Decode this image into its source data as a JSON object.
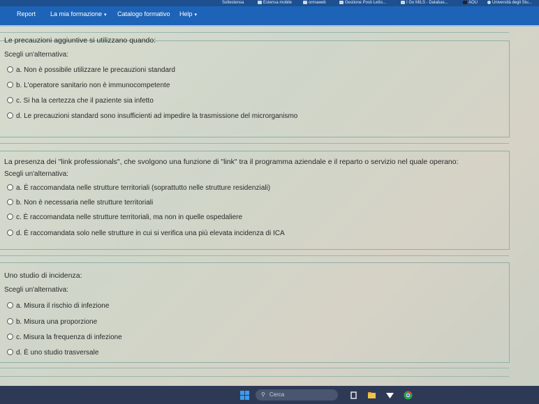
{
  "bookmarks": [
    {
      "label": "Soltestensa"
    },
    {
      "label": "Estensa mobile"
    },
    {
      "label": "ormaweb"
    },
    {
      "label": "Gestione Posti Letto..."
    },
    {
      "label": "I Go MILS - Databas..."
    },
    {
      "label": "AOU"
    },
    {
      "label": "Università degli Stu..."
    }
  ],
  "nav": {
    "report": "Report",
    "training": "La mia formazione",
    "catalog": "Catalogo formativo",
    "help": "Help"
  },
  "questions": [
    {
      "text": "Le precauzioni aggiuntive si utilizzano quando:",
      "prompt": "Scegli un'alternativa:",
      "options": [
        "a. Non è possibile utilizzare le precauzioni standard",
        "b. L'operatore sanitario non è immunocompetente",
        "c. Si ha la certezza che il paziente sia infetto",
        "d. Le precauzioni standard sono insufficienti ad impedire la trasmissione del microrganismo"
      ]
    },
    {
      "text": "La presenza dei \"link professionals\", che svolgono una funzione di \"link\" tra il programma aziendale e il reparto o servizio nel quale operano:",
      "prompt": "Scegli un'alternativa:",
      "options": [
        "a. È raccomandata nelle strutture territoriali (soprattutto nelle strutture residenziali)",
        "b. Non è necessaria nelle strutture territoriali",
        "c. È raccomandata nelle strutture territoriali, ma non in quelle ospedaliere",
        "d. È raccomandata solo nelle strutture in cui si verifica una più elevata incidenza di ICA"
      ]
    },
    {
      "text": "Uno studio di incidenza:",
      "prompt": "Scegli un'alternativa:",
      "options": [
        "a. Misura il rischio di infezione",
        "b. Misura una proporzione",
        "c. Misura la frequenza di infezione",
        "d. È uno studio trasversale"
      ]
    }
  ],
  "taskbar": {
    "search_placeholder": "Cerca"
  },
  "colors": {
    "navbar": "#1d63b8",
    "bookmarks_bar": "#1e4f8f",
    "taskbar": "#2e3a55"
  }
}
